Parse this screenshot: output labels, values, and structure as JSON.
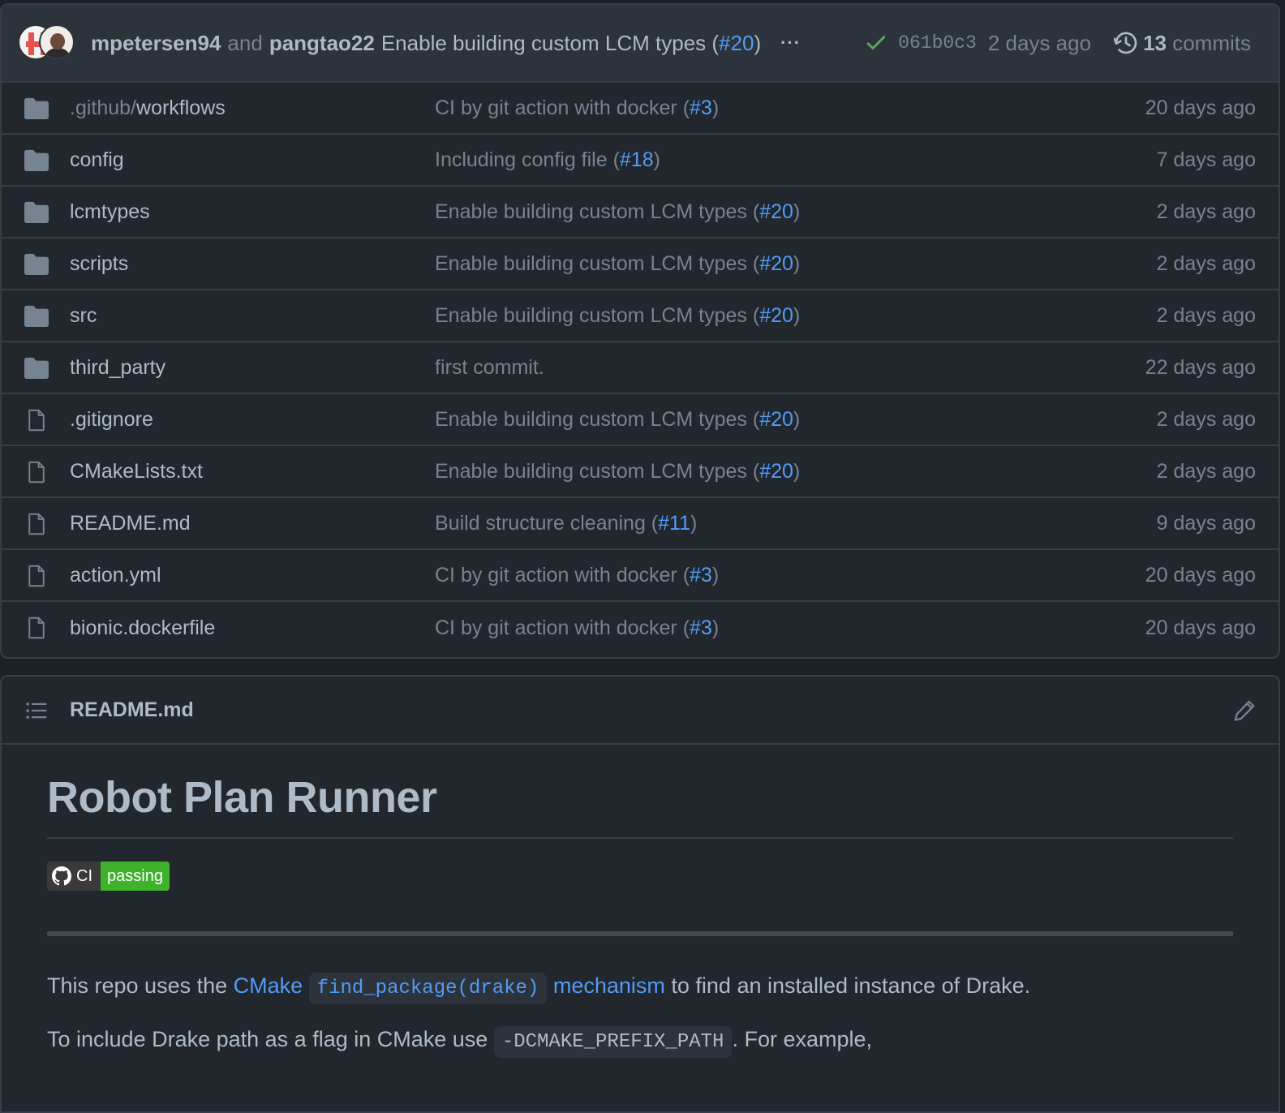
{
  "commit_bar": {
    "author1": "mpetersen94",
    "and": "and",
    "author2": "pangtao22",
    "message": "Enable building custom LCM types (",
    "pr": "#20",
    "message_end": ")",
    "more": "···",
    "sha": "061b0c3",
    "time": "2 days ago",
    "commits_count": "13",
    "commits_label": "commits",
    "status_color": "#57ab5a"
  },
  "files": [
    {
      "type": "folder",
      "prefix": ".github/",
      "name": "workflows",
      "msg": "CI by git action with docker (",
      "pr": "#3",
      "msg_end": ")",
      "age": "20 days ago"
    },
    {
      "type": "folder",
      "prefix": "",
      "name": "config",
      "msg": "Including config file (",
      "pr": "#18",
      "msg_end": ")",
      "age": "7 days ago"
    },
    {
      "type": "folder",
      "prefix": "",
      "name": "lcmtypes",
      "msg": "Enable building custom LCM types (",
      "pr": "#20",
      "msg_end": ")",
      "age": "2 days ago"
    },
    {
      "type": "folder",
      "prefix": "",
      "name": "scripts",
      "msg": "Enable building custom LCM types (",
      "pr": "#20",
      "msg_end": ")",
      "age": "2 days ago"
    },
    {
      "type": "folder",
      "prefix": "",
      "name": "src",
      "msg": "Enable building custom LCM types (",
      "pr": "#20",
      "msg_end": ")",
      "age": "2 days ago"
    },
    {
      "type": "folder",
      "prefix": "",
      "name": "third_party",
      "msg": "first commit.",
      "pr": "",
      "msg_end": "",
      "age": "22 days ago"
    },
    {
      "type": "file",
      "prefix": "",
      "name": ".gitignore",
      "msg": "Enable building custom LCM types (",
      "pr": "#20",
      "msg_end": ")",
      "age": "2 days ago"
    },
    {
      "type": "file",
      "prefix": "",
      "name": "CMakeLists.txt",
      "msg": "Enable building custom LCM types (",
      "pr": "#20",
      "msg_end": ")",
      "age": "2 days ago"
    },
    {
      "type": "file",
      "prefix": "",
      "name": "README.md",
      "msg": "Build structure cleaning (",
      "pr": "#11",
      "msg_end": ")",
      "age": "9 days ago"
    },
    {
      "type": "file",
      "prefix": "",
      "name": "action.yml",
      "msg": "CI by git action with docker (",
      "pr": "#3",
      "msg_end": ")",
      "age": "20 days ago"
    },
    {
      "type": "file",
      "prefix": "",
      "name": "bionic.dockerfile",
      "msg": "CI by git action with docker (",
      "pr": "#3",
      "msg_end": ")",
      "age": "20 days ago"
    }
  ],
  "readme": {
    "filename": "README.md",
    "title": "Robot Plan Runner",
    "badge_label": "CI",
    "badge_status": "passing",
    "badge_color": "#3fb22b",
    "p1_a": "This repo uses the ",
    "p1_link1": "CMake",
    "p1_code": "find_package(drake)",
    "p1_link2": "mechanism",
    "p1_b": " to find an installed instance of Drake.",
    "p2_a": "To include Drake path as a flag in CMake use ",
    "p2_code": "-DCMAKE_PREFIX_PATH",
    "p2_b": ". For example,"
  },
  "icons": {
    "folder": "folder-icon",
    "file": "file-icon",
    "check": "check-icon",
    "history": "history-icon",
    "list": "list-icon",
    "edit": "pencil-icon",
    "github": "github-mark-icon"
  }
}
